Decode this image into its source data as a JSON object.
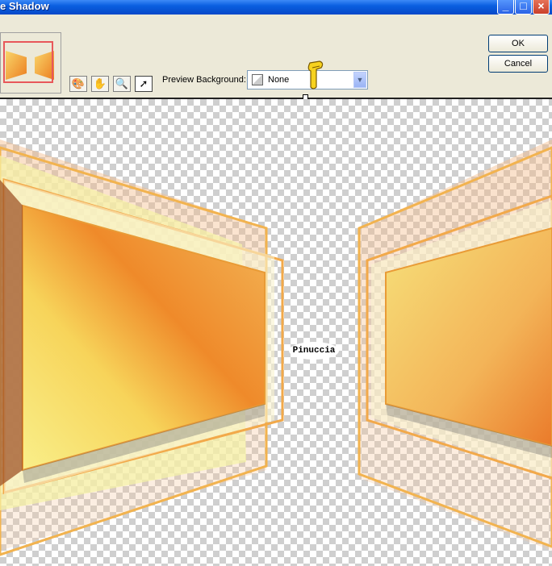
{
  "window": {
    "title": "e Shadow"
  },
  "titlebar_buttons": {
    "minimize": "_",
    "maximize": "□",
    "close": "×"
  },
  "buttons": {
    "ok": "OK",
    "cancel": "Cancel"
  },
  "preview": {
    "label": "Preview Background:",
    "selected": "None"
  },
  "watermark": {
    "text": "Pinuccia"
  },
  "colors": {
    "frame": "#f2a94a",
    "orange": "#ef8d2d",
    "yellow": "#f6e27a",
    "titlebar": "#0a5fe0"
  }
}
